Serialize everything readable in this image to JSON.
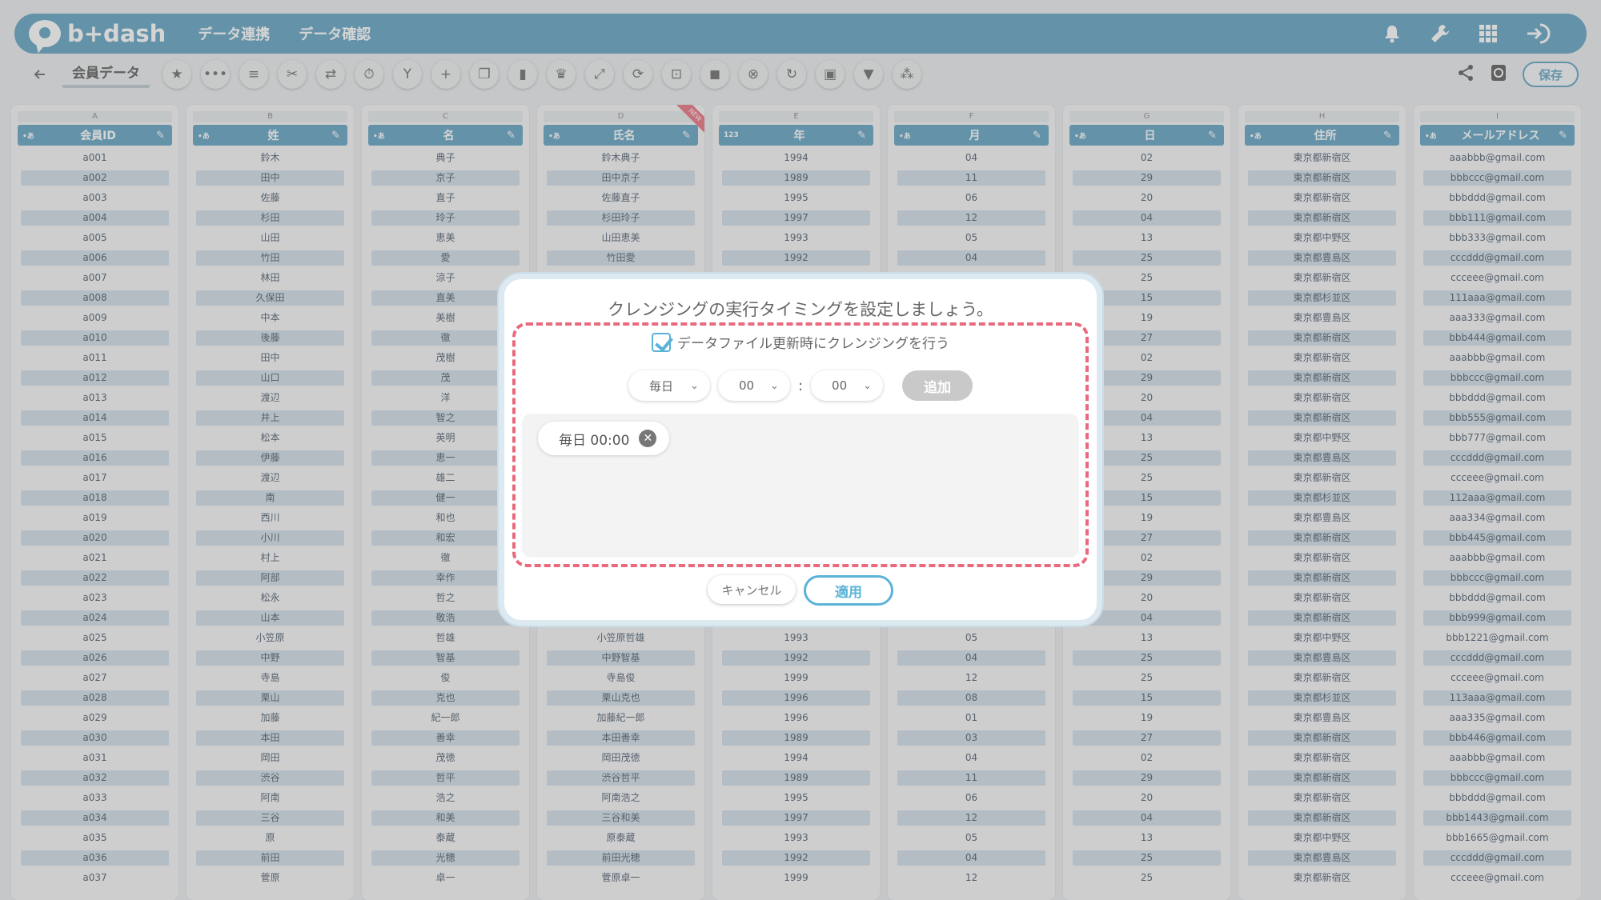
{
  "app": {
    "logo_text": "b+dash"
  },
  "topnav": {
    "items": [
      "データ連携",
      "データ確認"
    ]
  },
  "toolbar": {
    "tab_title": "会員データ",
    "save_label": "保存"
  },
  "columns": [
    {
      "letter": "A",
      "type": "•あ",
      "name": "会員ID",
      "cells": [
        "a001",
        "a002",
        "a003",
        "a004",
        "a005",
        "a006",
        "a007",
        "a008",
        "a009",
        "a010",
        "a011",
        "a012",
        "a013",
        "a014",
        "a015",
        "a016",
        "a017",
        "a018",
        "a019",
        "a020",
        "a021",
        "a022",
        "a023",
        "a024",
        "a025",
        "a026",
        "a027",
        "a028",
        "a029",
        "a030",
        "a031",
        "a032",
        "a033",
        "a034",
        "a035",
        "a036",
        "a037"
      ]
    },
    {
      "letter": "B",
      "type": "•あ",
      "name": "姓",
      "cells": [
        "鈴木",
        "田中",
        "佐藤",
        "杉田",
        "山田",
        "竹田",
        "林田",
        "久保田",
        "中本",
        "後藤",
        "田中",
        "山口",
        "渡辺",
        "井上",
        "松本",
        "伊藤",
        "渡辺",
        "南",
        "西川",
        "小川",
        "村上",
        "阿部",
        "松永",
        "山本",
        "小笠原",
        "中野",
        "寺島",
        "栗山",
        "加藤",
        "本田",
        "岡田",
        "渋谷",
        "阿南",
        "三谷",
        "原",
        "前田",
        "菅原"
      ]
    },
    {
      "letter": "C",
      "type": "•あ",
      "name": "名",
      "cells": [
        "典子",
        "京子",
        "直子",
        "玲子",
        "恵美",
        "愛",
        "涼子",
        "直美",
        "美樹",
        "徹",
        "茂樹",
        "茂",
        "洋",
        "智之",
        "英明",
        "恵一",
        "雄二",
        "健一",
        "和也",
        "和宏",
        "徹",
        "幸作",
        "哲之",
        "敬浩",
        "哲雄",
        "智基",
        "俊",
        "克也",
        "紀一郎",
        "善幸",
        "茂徳",
        "哲平",
        "浩之",
        "和美",
        "泰蔵",
        "光穂",
        "卓一"
      ]
    },
    {
      "letter": "D",
      "type": "•あ",
      "name": "氏名",
      "cells": [
        "鈴木典子",
        "田中京子",
        "佐藤直子",
        "杉田玲子",
        "山田恵美",
        "竹田愛",
        "",
        "",
        "",
        "",
        "",
        "",
        "",
        "",
        "",
        "",
        "",
        "",
        "",
        "",
        "",
        "",
        "",
        "",
        "小笠原哲雄",
        "中野智基",
        "寺島俊",
        "栗山克也",
        "加藤紀一郎",
        "本田善幸",
        "岡田茂徳",
        "渋谷哲平",
        "阿南浩之",
        "三谷和美",
        "原泰蔵",
        "前田光穂",
        "菅原卓一"
      ],
      "badge": "NEW"
    },
    {
      "letter": "E",
      "type": "123",
      "name": "年",
      "cells": [
        "1994",
        "1989",
        "1995",
        "1997",
        "1993",
        "1992",
        "",
        "",
        "",
        "",
        "",
        "",
        "",
        "",
        "",
        "",
        "",
        "",
        "",
        "",
        "",
        "",
        "",
        "",
        "1993",
        "1992",
        "1999",
        "1996",
        "1996",
        "1989",
        "1994",
        "1989",
        "1995",
        "1997",
        "1993",
        "1992",
        "1999"
      ]
    },
    {
      "letter": "F",
      "type": "•あ",
      "name": "月",
      "cells": [
        "04",
        "11",
        "06",
        "12",
        "05",
        "04",
        "",
        "",
        "",
        "",
        "",
        "",
        "",
        "",
        "",
        "",
        "",
        "",
        "",
        "",
        "",
        "",
        "",
        "",
        "05",
        "04",
        "12",
        "08",
        "01",
        "03",
        "04",
        "11",
        "06",
        "12",
        "05",
        "04",
        "12"
      ]
    },
    {
      "letter": "G",
      "type": "•あ",
      "name": "日",
      "cells": [
        "02",
        "29",
        "20",
        "04",
        "13",
        "25",
        "25",
        "15",
        "19",
        "27",
        "02",
        "29",
        "20",
        "04",
        "13",
        "25",
        "25",
        "15",
        "19",
        "27",
        "02",
        "29",
        "20",
        "04",
        "13",
        "25",
        "25",
        "15",
        "19",
        "27",
        "02",
        "29",
        "20",
        "04",
        "13",
        "25",
        "25"
      ]
    },
    {
      "letter": "H",
      "type": "•あ",
      "name": "住所",
      "cells": [
        "東京都新宿区",
        "東京都新宿区",
        "東京都新宿区",
        "東京都新宿区",
        "東京都中野区",
        "東京都豊島区",
        "東京都新宿区",
        "東京都杉並区",
        "東京都豊島区",
        "東京都新宿区",
        "東京都新宿区",
        "東京都新宿区",
        "東京都新宿区",
        "東京都新宿区",
        "東京都中野区",
        "東京都豊島区",
        "東京都新宿区",
        "東京都杉並区",
        "東京都豊島区",
        "東京都新宿区",
        "東京都新宿区",
        "東京都新宿区",
        "東京都新宿区",
        "東京都新宿区",
        "東京都中野区",
        "東京都豊島区",
        "東京都新宿区",
        "東京都杉並区",
        "東京都豊島区",
        "東京都新宿区",
        "東京都新宿区",
        "東京都新宿区",
        "東京都新宿区",
        "東京都新宿区",
        "東京都中野区",
        "東京都豊島区",
        "東京都新宿区"
      ]
    },
    {
      "letter": "I",
      "type": "•あ",
      "name": "メールアドレス",
      "cells": [
        "aaabbb@gmail.com",
        "bbbccc@gmail.com",
        "bbbddd@gmail.com",
        "bbb111@gmail.com",
        "bbb333@gmail.com",
        "cccddd@gmail.com",
        "ccceee@gmail.com",
        "111aaa@gmail.com",
        "aaa333@gmail.com",
        "bbb444@gmail.com",
        "aaabbb@gmail.com",
        "bbbccc@gmail.com",
        "bbbddd@gmail.com",
        "bbb555@gmail.com",
        "bbb777@gmail.com",
        "cccddd@gmail.com",
        "ccceee@gmail.com",
        "112aaa@gmail.com",
        "aaa334@gmail.com",
        "bbb445@gmail.com",
        "aaabbb@gmail.com",
        "bbbccc@gmail.com",
        "bbbddd@gmail.com",
        "bbb999@gmail.com",
        "bbb1221@gmail.com",
        "cccddd@gmail.com",
        "ccceee@gmail.com",
        "113aaa@gmail.com",
        "aaa335@gmail.com",
        "bbb446@gmail.com",
        "aaabbb@gmail.com",
        "bbbccc@gmail.com",
        "bbbddd@gmail.com",
        "bbb1443@gmail.com",
        "bbb1665@gmail.com",
        "cccddd@gmail.com",
        "ccceee@gmail.com"
      ]
    }
  ],
  "modal": {
    "title": "クレンジングの実行タイミングを設定しましょう。",
    "checkbox_label": "データファイル更新時にクレンジングを行う",
    "frequency": "毎日",
    "hour": "00",
    "minute": "00",
    "colon": ":",
    "add_label": "追加",
    "schedule": [
      "毎日 00:00"
    ],
    "cancel_label": "キャンセル",
    "apply_label": "適用"
  }
}
